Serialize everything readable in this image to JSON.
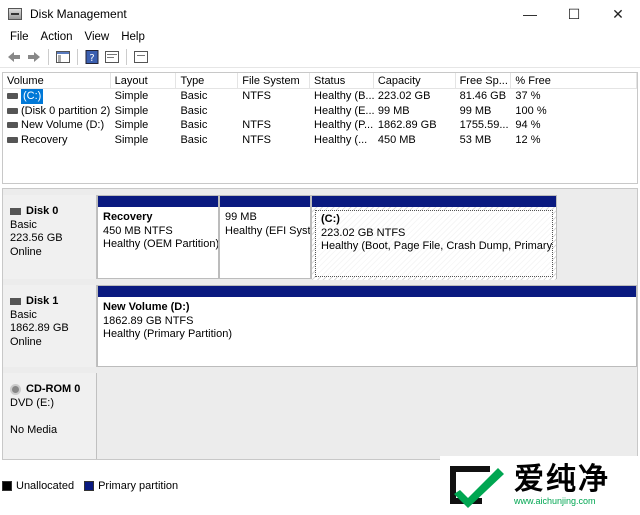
{
  "window": {
    "title": "Disk Management",
    "minimize": "—",
    "maximize": "☐",
    "close": "✕"
  },
  "menu": [
    "File",
    "Action",
    "View",
    "Help"
  ],
  "columns": [
    "Volume",
    "Layout",
    "Type",
    "File System",
    "Status",
    "Capacity",
    "Free Sp...",
    "% Free"
  ],
  "volumes": [
    [
      "(C:)",
      "Simple",
      "Basic",
      "NTFS",
      "Healthy (B...",
      "223.02 GB",
      "81.46 GB",
      "37 %"
    ],
    [
      "(Disk 0 partition 2)",
      "Simple",
      "Basic",
      "",
      "Healthy (E...",
      "99 MB",
      "99 MB",
      "100 %"
    ],
    [
      "New Volume (D:)",
      "Simple",
      "Basic",
      "NTFS",
      "Healthy (P...",
      "1862.89 GB",
      "1755.59...",
      "94 %"
    ],
    [
      "Recovery",
      "Simple",
      "Basic",
      "NTFS",
      "Healthy (...",
      "450 MB",
      "53 MB",
      "12 %"
    ]
  ],
  "disks": [
    {
      "name": "Disk 0",
      "type": "Basic",
      "size": "223.56 GB",
      "status": "Online",
      "partitions": [
        {
          "name": "Recovery",
          "size": "450 MB NTFS",
          "status": "Healthy (OEM Partition)"
        },
        {
          "name": "",
          "size": "99 MB",
          "status": "Healthy (EFI Syste"
        },
        {
          "name": "(C:)",
          "size": "223.02 GB NTFS",
          "status": "Healthy (Boot, Page File, Crash Dump, Primary Partit"
        }
      ]
    },
    {
      "name": "Disk 1",
      "type": "Basic",
      "size": "1862.89 GB",
      "status": "Online",
      "partitions": [
        {
          "name": "New Volume  (D:)",
          "size": "1862.89 GB NTFS",
          "status": "Healthy (Primary Partition)"
        }
      ]
    },
    {
      "name": "CD-ROM 0",
      "type": "DVD (E:)",
      "media": "No Media"
    }
  ],
  "legend": {
    "unallocated": "Unallocated",
    "primary": "Primary partition"
  },
  "watermark": {
    "text": "爱纯净",
    "url": "www.aichunjing.com"
  },
  "colors": {
    "primary_bar": "#0a1a80",
    "selection": "#0078d7",
    "watermark_green": "#00a651"
  }
}
